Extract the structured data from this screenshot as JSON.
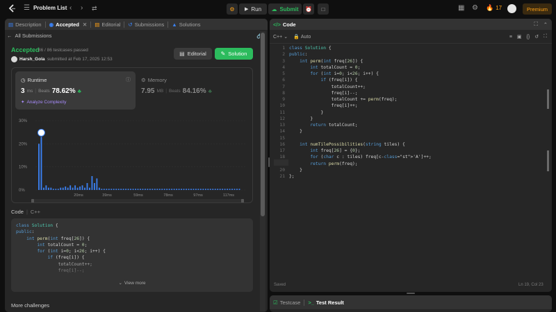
{
  "topbar": {
    "problem_list": "Problem List",
    "run": "Run",
    "submit": "Submit",
    "streak": "17",
    "premium": "Premium"
  },
  "left_tabs": [
    "Description",
    "Accepted",
    "Editorial",
    "Submissions",
    "Solutions"
  ],
  "back": "All Submissions",
  "result": {
    "status": "Accepted",
    "passed": "86 / 86 testcases passed",
    "user": "Harsh_Gola",
    "submitted": "submitted at Feb 17, 2025 12:53",
    "editorial_btn": "Editorial",
    "solution_btn": "Solution"
  },
  "runtime": {
    "label": "Runtime",
    "value": "3",
    "unit": "ms",
    "beats_label": "Beats",
    "beats": "78.62%",
    "analyze": "Analyze Complexity"
  },
  "memory": {
    "label": "Memory",
    "value": "7.95",
    "unit": "MB",
    "beats_label": "Beats",
    "beats": "84.16%"
  },
  "chart_data": {
    "type": "bar",
    "ylabel": "",
    "ylim": [
      0,
      30
    ],
    "y_ticks": [
      "30%",
      "20%",
      "10%",
      "0%"
    ],
    "x_ticks": [
      "20ms",
      "39ms",
      "59ms",
      "78ms",
      "97ms",
      "117ms"
    ],
    "values": [
      20,
      23,
      1,
      2,
      1,
      1,
      0.5,
      0.5,
      0.5,
      1,
      1,
      1.5,
      1,
      2,
      1,
      2,
      1,
      1.5,
      2,
      1,
      3,
      1,
      6,
      3,
      5,
      1,
      0.5,
      0.5,
      0.5,
      0.5,
      0.5,
      0.5,
      0.5,
      0.5,
      0.5,
      0.5,
      0.5,
      0.5,
      0.5,
      0.5,
      0.5,
      0.5,
      0.5,
      0.5,
      0.5,
      0.5,
      0.5,
      0.5,
      0.5,
      0.5,
      0.5,
      0.5,
      0.5,
      0.5,
      0.5,
      0.5,
      0.5,
      0.5,
      0.5,
      0.5,
      0.5,
      0.5,
      0.5,
      0.5,
      0.5,
      0.5,
      0.5,
      0.5,
      0.5,
      0.5,
      0.5,
      0.5,
      0.5,
      0.5,
      0.5,
      0.5,
      0.5,
      0.5,
      0.5,
      0.5,
      0.5,
      0.5,
      0.5,
      0.5
    ],
    "highlight_index": 1,
    "bar_color": "#3b82f6"
  },
  "code_section": {
    "label": "Code",
    "lang": "C++",
    "view_more": "View more",
    "more_challenges": "More challenges"
  },
  "preview_code": [
    "class Solution {",
    "public:",
    "    int perm(int freq[26]) {",
    "        int totalCount = 0;",
    "        for (int i=0; i<26; i++) {",
    "            if (freq[i]) {",
    "                totalCount++;",
    "                freq[i]--;"
  ],
  "editor": {
    "title": "Code",
    "lang": "C++",
    "mode": "Auto",
    "saved": "Saved",
    "cursor": "Ln 19, Col 23",
    "lines": [
      "class Solution {",
      "public:",
      "    int perm(int freq[26]) {",
      "        int totalCount = 0;",
      "        for (int i=0; i<26; i++) {",
      "            if (freq[i]) {",
      "                totalCount++;",
      "                freq[i]--;",
      "                totalCount += perm(freq);",
      "                freq[i]++;",
      "            }",
      "        }",
      "        return totalCount;",
      "    }",
      "",
      "    int numTilePossibilities(string tiles) {",
      "        int freq[26] = {0};",
      "        for (char c : tiles) freq[c-'A']++;",
      "        return perm(freq);",
      "    }",
      "};"
    ],
    "line_numbers": [
      "1",
      "2",
      "3",
      "4",
      "5",
      "6",
      "7",
      "8",
      "9",
      "10",
      "11",
      "12",
      "13",
      "14",
      "15",
      "16",
      "17",
      "18",
      "19",
      "20",
      "21"
    ]
  },
  "bottom_tabs": {
    "testcase": "Testcase",
    "test_result": "Test Result"
  },
  "colors": {
    "accent_green": "#2cbb5d",
    "accent_blue": "#3b82f6",
    "premium": "#ffa116"
  }
}
